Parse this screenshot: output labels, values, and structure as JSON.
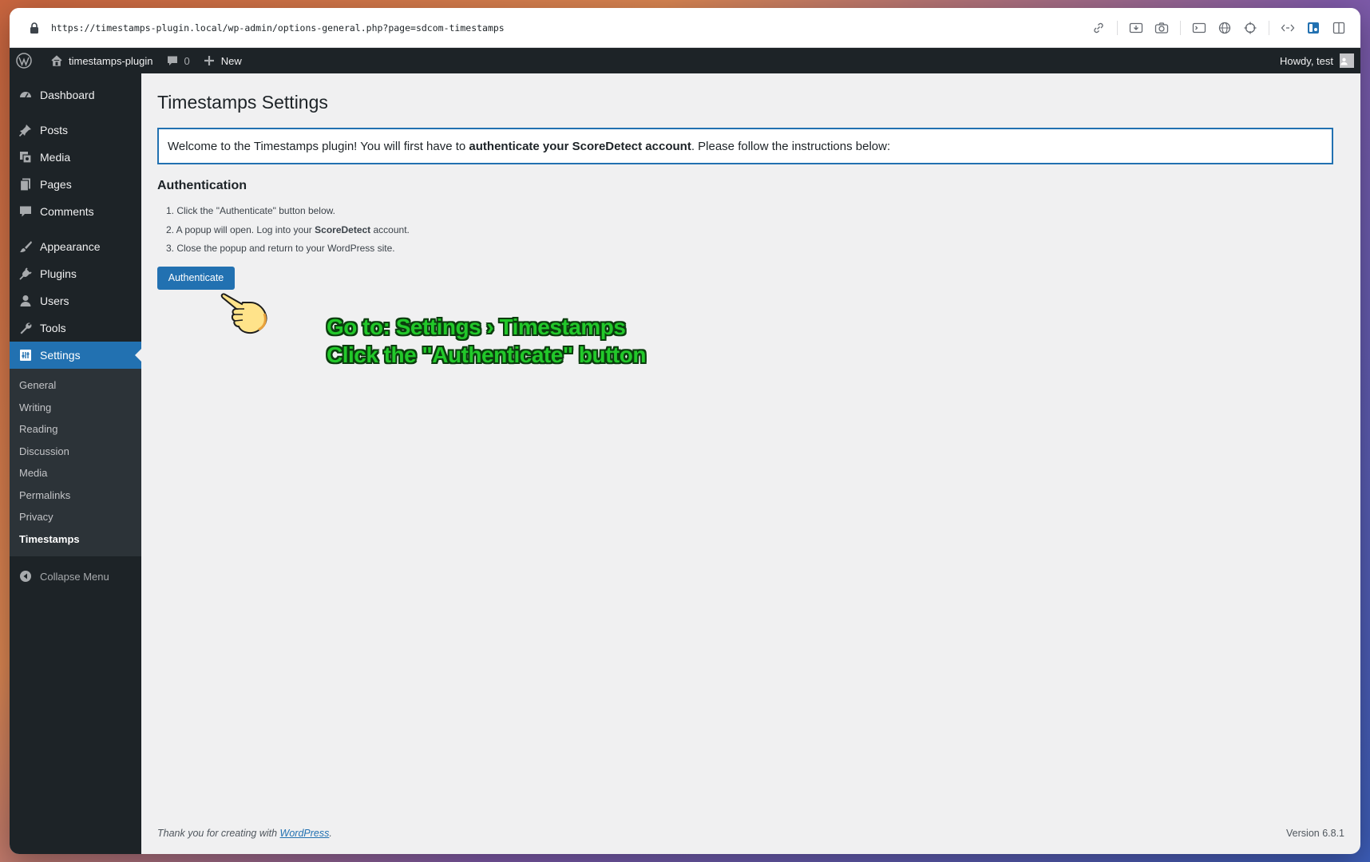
{
  "browser": {
    "url": "https://timestamps-plugin.local/wp-admin/options-general.php?page=sdcom-timestamps",
    "toolbar_icons": [
      "link-icon",
      "download-icon",
      "camera-icon",
      "terminal-icon",
      "globe-icon",
      "crosshair-icon",
      "extensions-icon",
      "sidebar-icon",
      "split-view-icon"
    ]
  },
  "adminbar": {
    "site_name": "timestamps-plugin",
    "comments_count": "0",
    "new_label": "New",
    "howdy": "Howdy, test"
  },
  "sidebar": {
    "items": [
      {
        "label": "Dashboard",
        "icon": "dashboard-icon"
      },
      {
        "label": "Posts",
        "icon": "pin-icon"
      },
      {
        "label": "Media",
        "icon": "media-icon"
      },
      {
        "label": "Pages",
        "icon": "pages-icon"
      },
      {
        "label": "Comments",
        "icon": "comment-icon"
      },
      {
        "label": "Appearance",
        "icon": "brush-icon"
      },
      {
        "label": "Plugins",
        "icon": "plug-icon"
      },
      {
        "label": "Users",
        "icon": "user-icon"
      },
      {
        "label": "Tools",
        "icon": "wrench-icon"
      },
      {
        "label": "Settings",
        "icon": "settings-icon"
      }
    ],
    "submenu": [
      "General",
      "Writing",
      "Reading",
      "Discussion",
      "Media",
      "Permalinks",
      "Privacy",
      "Timestamps"
    ],
    "collapse_label": "Collapse Menu"
  },
  "main": {
    "title": "Timestamps Settings",
    "notice_pre": "Welcome to the Timestamps plugin! You will first have to ",
    "notice_bold": "authenticate your ScoreDetect account",
    "notice_post": ". Please follow the instructions below:",
    "section_title": "Authentication",
    "step1": "1. Click the \"Authenticate\" button below.",
    "step2_pre": "2. A popup will open. Log into your ",
    "step2_bold": "ScoreDetect",
    "step2_post": " account.",
    "step3": "3. Close the popup and return to your WordPress site.",
    "button_label": "Authenticate"
  },
  "overlay": {
    "line1": "Go to: Settings › Timestamps",
    "line2": "Click the \"Authenticate\" button"
  },
  "footer": {
    "thanks_pre": "Thank you for creating with ",
    "link": "WordPress",
    "thanks_post": ".",
    "version": "Version 6.8.1"
  },
  "colors": {
    "admin_dark": "#1d2327",
    "accent": "#2271b1",
    "overlay_green": "#22c82a"
  }
}
